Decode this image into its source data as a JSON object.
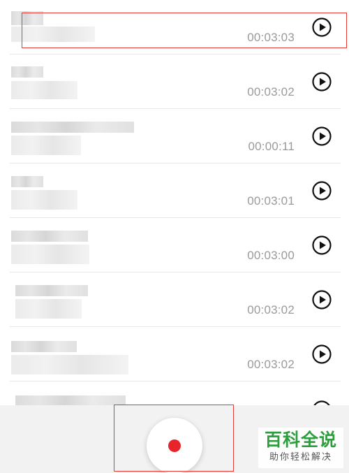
{
  "recordings": [
    {
      "duration": "00:03:03"
    },
    {
      "duration": "00:03:02"
    },
    {
      "duration": "00:00:11"
    },
    {
      "duration": "00:03:01"
    },
    {
      "duration": "00:03:00"
    },
    {
      "duration": "00:03:02"
    },
    {
      "duration": "00:03:02"
    }
  ],
  "icons": {
    "play": "play-circle-icon",
    "record": "record-dot-icon"
  },
  "colors": {
    "record_dot": "#e8242b",
    "highlight": "#e53935",
    "duration_text": "#9a9a9a",
    "watermark_green": "#2e9e3e"
  },
  "watermark": {
    "title": "百科全说",
    "subtitle": "助你轻松解决"
  }
}
